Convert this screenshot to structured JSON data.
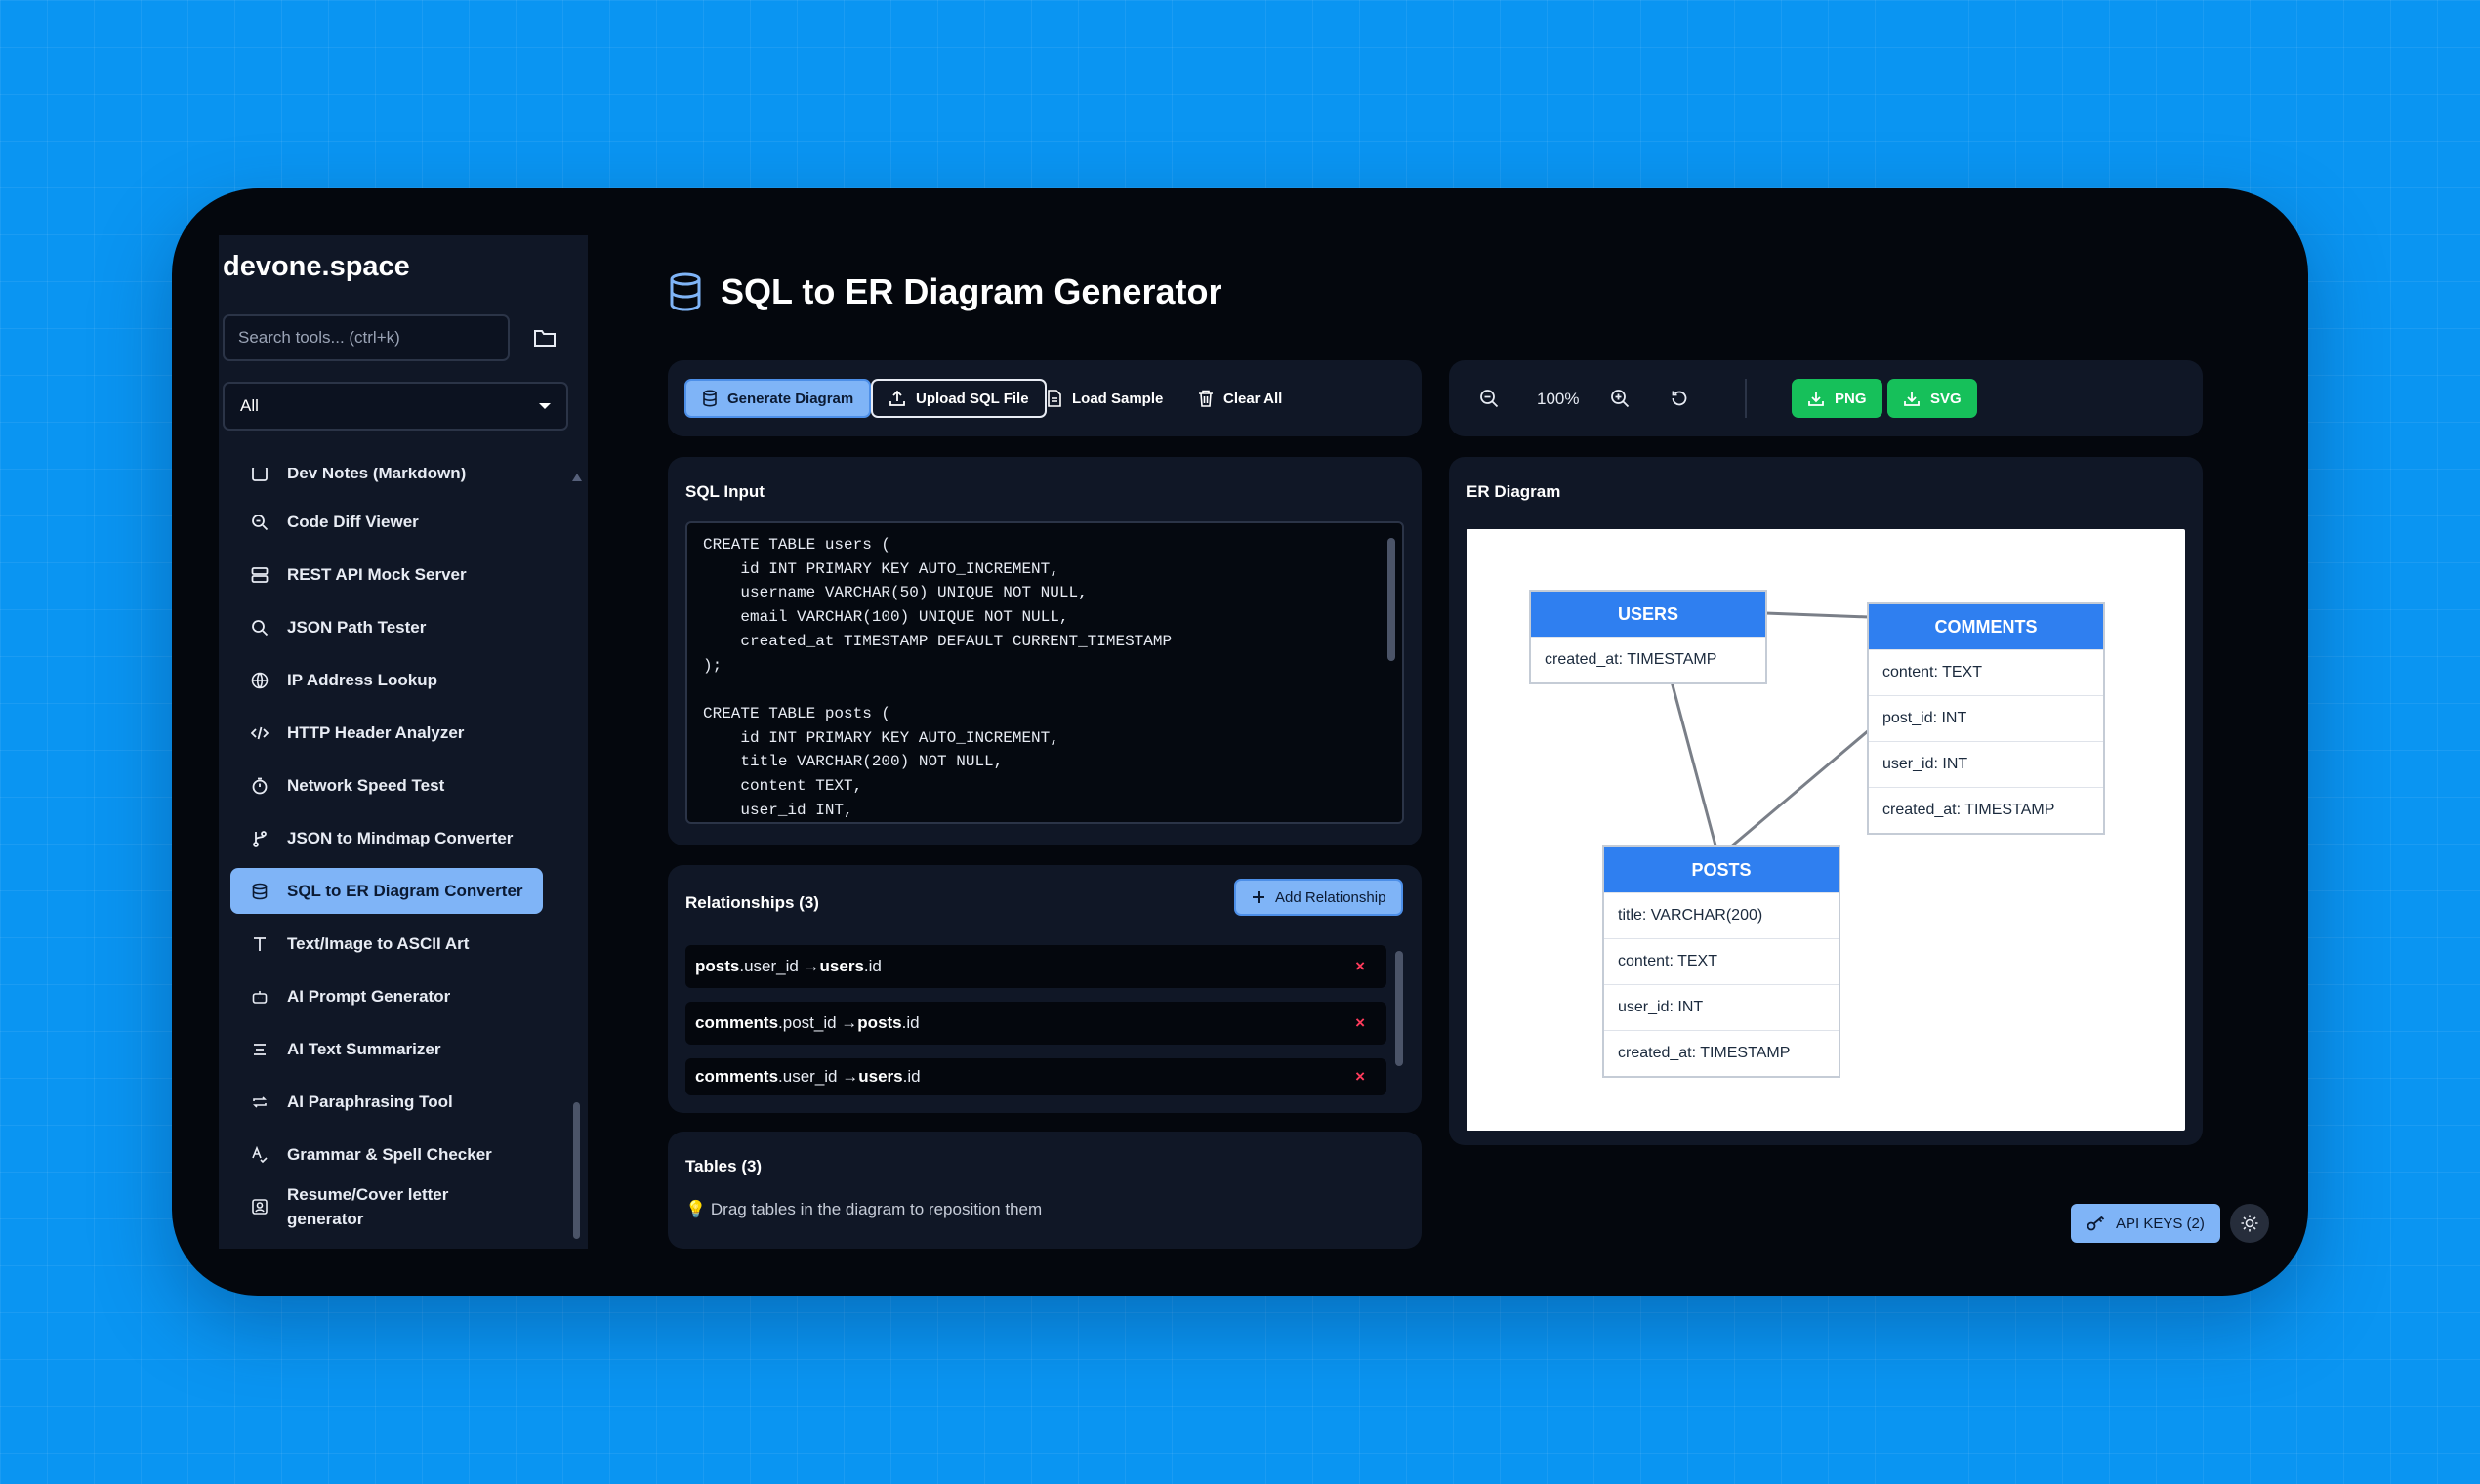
{
  "app": {
    "brand": "devone.space",
    "search_placeholder": "Search tools... (ctrl+k)",
    "category_selected": "All"
  },
  "sidebar": {
    "items": [
      {
        "label": "Dev Notes (Markdown)",
        "icon": "notes-icon"
      },
      {
        "label": "Code Diff Viewer",
        "icon": "magnifier-icon"
      },
      {
        "label": "REST API Mock Server",
        "icon": "server-icon"
      },
      {
        "label": "JSON Path Tester",
        "icon": "magnifier-icon"
      },
      {
        "label": "IP Address Lookup",
        "icon": "globe-icon"
      },
      {
        "label": "HTTP Header Analyzer",
        "icon": "code-icon"
      },
      {
        "label": "Network Speed Test",
        "icon": "timer-icon"
      },
      {
        "label": "JSON to Mindmap Converter",
        "icon": "branch-icon"
      },
      {
        "label": "SQL to ER Diagram Converter",
        "icon": "database-icon",
        "active": true
      },
      {
        "label": "Text/Image to ASCII Art",
        "icon": "text-icon"
      },
      {
        "label": "AI Prompt Generator",
        "icon": "robot-icon"
      },
      {
        "label": "AI Text Summarizer",
        "icon": "list-icon"
      },
      {
        "label": "AI Paraphrasing Tool",
        "icon": "repeat-icon"
      },
      {
        "label": "Grammar & Spell Checker",
        "icon": "spellcheck-icon"
      },
      {
        "label": "Resume/Cover letter generator",
        "icon": "badge-icon"
      }
    ]
  },
  "page": {
    "title": "SQL to ER Diagram Generator"
  },
  "toolbar": {
    "generate": "Generate Diagram",
    "upload": "Upload SQL File",
    "load_sample": "Load Sample",
    "clear_all": "Clear All",
    "zoom": "100%",
    "png": "PNG",
    "svg": "SVG"
  },
  "sql_input": {
    "title": "SQL Input",
    "code": "CREATE TABLE users (\n    id INT PRIMARY KEY AUTO_INCREMENT,\n    username VARCHAR(50) UNIQUE NOT NULL,\n    email VARCHAR(100) UNIQUE NOT NULL,\n    created_at TIMESTAMP DEFAULT CURRENT_TIMESTAMP\n);\n\nCREATE TABLE posts (\n    id INT PRIMARY KEY AUTO_INCREMENT,\n    title VARCHAR(200) NOT NULL,\n    content TEXT,\n    user_id INT,\n    created_at TIMESTAMP DEFAULT CURRENT_TIMESTAMP"
  },
  "relationships": {
    "title": "Relationships (3)",
    "add_label": "Add Relationship",
    "remove_symbol": "×",
    "items": [
      {
        "from_table": "posts",
        "from_col": ".user_id → ",
        "to_table": "users",
        "to_col": ".id"
      },
      {
        "from_table": "comments",
        "from_col": ".post_id → ",
        "to_table": "posts",
        "to_col": ".id"
      },
      {
        "from_table": "comments",
        "from_col": ".user_id → ",
        "to_table": "users",
        "to_col": ".id"
      }
    ]
  },
  "tables": {
    "title": "Tables (3)",
    "hint": "Drag tables in the diagram to reposition them"
  },
  "er": {
    "title": "ER Diagram",
    "entities": [
      {
        "name": "USERS",
        "fields": [
          "created_at: TIMESTAMP"
        ]
      },
      {
        "name": "COMMENTS",
        "fields": [
          "content: TEXT",
          "post_id: INT",
          "user_id: INT",
          "created_at: TIMESTAMP"
        ]
      },
      {
        "name": "POSTS",
        "fields": [
          "title: VARCHAR(200)",
          "content: TEXT",
          "user_id: INT",
          "created_at: TIMESTAMP"
        ]
      }
    ]
  },
  "footer": {
    "api_keys": "API KEYS (2)"
  },
  "colors": {
    "background": "#0a95f2",
    "window": "#04070d",
    "panel": "#101726",
    "accent": "#7fb4f7",
    "entity_header": "#2f7ff0",
    "success": "#16c05a",
    "danger": "#ff3b5c"
  }
}
